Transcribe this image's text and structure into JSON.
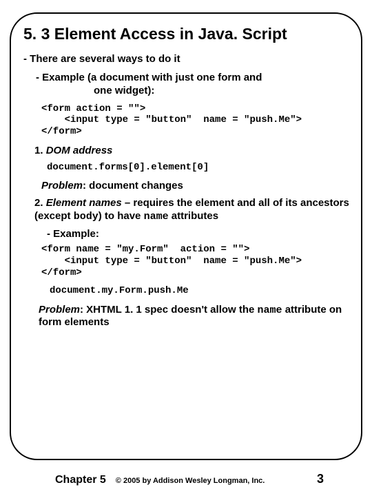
{
  "title": "5. 3 Element Access in Java. Script",
  "bullet1": "- There are several ways to do it",
  "example_label_line1": "- Example (a document with just one form and",
  "example_label_line2": "one widget):",
  "code1": "<form action = \"\">\n    <input type = \"button\"  name = \"push.Me\">\n</form>",
  "item1_label": "1. ",
  "item1_title": "DOM address",
  "code2": "document.forms[0].element[0]",
  "problem1_label": "Problem",
  "problem1_text": ": document changes",
  "item2_label": "2. ",
  "item2_title": "Element names",
  "item2_rest1": " – requires the element and all of its ancestors (except ",
  "item2_code": "body",
  "item2_rest2": ") to have ",
  "item2_code2": "name",
  "item2_rest3": " attributes",
  "example2_label": "- Example:",
  "code3": "<form name = \"my.Form\"  action = \"\">\n    <input type = \"button\"  name = \"push.Me\">\n</form>",
  "code4": "document.my.Form.push.Me",
  "problem2_label": "Problem",
  "problem2_text1": ": XHTML 1. 1 spec doesn't allow the ",
  "problem2_code": "name",
  "problem2_text2": " attribute on form elements",
  "footer_chapter": "Chapter 5",
  "footer_copy": "© 2005 by Addison Wesley Longman, Inc.",
  "footer_page": "3"
}
